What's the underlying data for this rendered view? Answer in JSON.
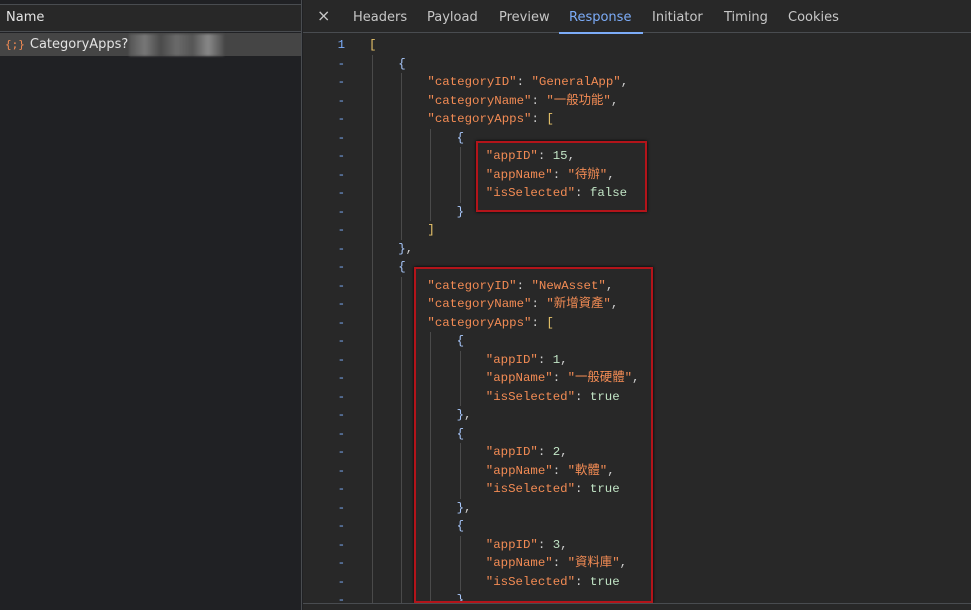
{
  "network": {
    "name_header": "Name",
    "request": {
      "name": "CategoryApps?",
      "icon": "json-braces-icon"
    }
  },
  "tabs": [
    "Headers",
    "Payload",
    "Preview",
    "Response",
    "Initiator",
    "Timing",
    "Cookies"
  ],
  "active_tab": "Response",
  "close_icon": "×",
  "colors": {
    "key": "#f28b54",
    "number": "#c1e4c5",
    "accent": "#7cacf8",
    "highlight_box": "#b3141a"
  },
  "response_lines": [
    {
      "ln": "1",
      "i": 0,
      "t": [
        [
          "br",
          "["
        ]
      ]
    },
    {
      "ln": "-",
      "i": 1,
      "t": [
        [
          "cb",
          "{"
        ]
      ]
    },
    {
      "ln": "-",
      "i": 2,
      "t": [
        [
          "k",
          "\"categoryID\""
        ],
        [
          "p",
          ": "
        ],
        [
          "s",
          "\"GeneralApp\""
        ],
        [
          "p",
          ","
        ]
      ]
    },
    {
      "ln": "-",
      "i": 2,
      "t": [
        [
          "k",
          "\"categoryName\""
        ],
        [
          "p",
          ": "
        ],
        [
          "s",
          "\"一般功能\""
        ],
        [
          "p",
          ","
        ]
      ]
    },
    {
      "ln": "-",
      "i": 2,
      "t": [
        [
          "k",
          "\"categoryApps\""
        ],
        [
          "p",
          ": "
        ],
        [
          "br",
          "["
        ]
      ]
    },
    {
      "ln": "-",
      "i": 3,
      "t": [
        [
          "cb",
          "{"
        ]
      ]
    },
    {
      "ln": "-",
      "i": 4,
      "t": [
        [
          "k",
          "\"appID\""
        ],
        [
          "p",
          ": "
        ],
        [
          "n",
          "15"
        ],
        [
          "p",
          ","
        ]
      ]
    },
    {
      "ln": "-",
      "i": 4,
      "t": [
        [
          "k",
          "\"appName\""
        ],
        [
          "p",
          ": "
        ],
        [
          "s",
          "\"待辦\""
        ],
        [
          "p",
          ","
        ]
      ]
    },
    {
      "ln": "-",
      "i": 4,
      "t": [
        [
          "k",
          "\"isSelected\""
        ],
        [
          "p",
          ": "
        ],
        [
          "n",
          "false"
        ]
      ]
    },
    {
      "ln": "-",
      "i": 3,
      "t": [
        [
          "cb",
          "}"
        ]
      ]
    },
    {
      "ln": "-",
      "i": 2,
      "t": [
        [
          "br",
          "]"
        ]
      ]
    },
    {
      "ln": "-",
      "i": 1,
      "t": [
        [
          "cb",
          "}"
        ],
        [
          "p",
          ","
        ]
      ]
    },
    {
      "ln": "-",
      "i": 1,
      "t": [
        [
          "cb",
          "{"
        ]
      ]
    },
    {
      "ln": "-",
      "i": 2,
      "t": [
        [
          "k",
          "\"categoryID\""
        ],
        [
          "p",
          ": "
        ],
        [
          "s",
          "\"NewAsset\""
        ],
        [
          "p",
          ","
        ]
      ]
    },
    {
      "ln": "-",
      "i": 2,
      "t": [
        [
          "k",
          "\"categoryName\""
        ],
        [
          "p",
          ": "
        ],
        [
          "s",
          "\"新增資產\""
        ],
        [
          "p",
          ","
        ]
      ]
    },
    {
      "ln": "-",
      "i": 2,
      "t": [
        [
          "k",
          "\"categoryApps\""
        ],
        [
          "p",
          ": "
        ],
        [
          "br",
          "["
        ]
      ]
    },
    {
      "ln": "-",
      "i": 3,
      "t": [
        [
          "cb",
          "{"
        ]
      ]
    },
    {
      "ln": "-",
      "i": 4,
      "t": [
        [
          "k",
          "\"appID\""
        ],
        [
          "p",
          ": "
        ],
        [
          "n",
          "1"
        ],
        [
          "p",
          ","
        ]
      ]
    },
    {
      "ln": "-",
      "i": 4,
      "t": [
        [
          "k",
          "\"appName\""
        ],
        [
          "p",
          ": "
        ],
        [
          "s",
          "\"一般硬體\""
        ],
        [
          "p",
          ","
        ]
      ]
    },
    {
      "ln": "-",
      "i": 4,
      "t": [
        [
          "k",
          "\"isSelected\""
        ],
        [
          "p",
          ": "
        ],
        [
          "n",
          "true"
        ]
      ]
    },
    {
      "ln": "-",
      "i": 3,
      "t": [
        [
          "cb",
          "}"
        ],
        [
          "p",
          ","
        ]
      ]
    },
    {
      "ln": "-",
      "i": 3,
      "t": [
        [
          "cb",
          "{"
        ]
      ]
    },
    {
      "ln": "-",
      "i": 4,
      "t": [
        [
          "k",
          "\"appID\""
        ],
        [
          "p",
          ": "
        ],
        [
          "n",
          "2"
        ],
        [
          "p",
          ","
        ]
      ]
    },
    {
      "ln": "-",
      "i": 4,
      "t": [
        [
          "k",
          "\"appName\""
        ],
        [
          "p",
          ": "
        ],
        [
          "s",
          "\"軟體\""
        ],
        [
          "p",
          ","
        ]
      ]
    },
    {
      "ln": "-",
      "i": 4,
      "t": [
        [
          "k",
          "\"isSelected\""
        ],
        [
          "p",
          ": "
        ],
        [
          "n",
          "true"
        ]
      ]
    },
    {
      "ln": "-",
      "i": 3,
      "t": [
        [
          "cb",
          "}"
        ],
        [
          "p",
          ","
        ]
      ]
    },
    {
      "ln": "-",
      "i": 3,
      "t": [
        [
          "cb",
          "{"
        ]
      ]
    },
    {
      "ln": "-",
      "i": 4,
      "t": [
        [
          "k",
          "\"appID\""
        ],
        [
          "p",
          ": "
        ],
        [
          "n",
          "3"
        ],
        [
          "p",
          ","
        ]
      ]
    },
    {
      "ln": "-",
      "i": 4,
      "t": [
        [
          "k",
          "\"appName\""
        ],
        [
          "p",
          ": "
        ],
        [
          "s",
          "\"資料庫\""
        ],
        [
          "p",
          ","
        ]
      ]
    },
    {
      "ln": "-",
      "i": 4,
      "t": [
        [
          "k",
          "\"isSelected\""
        ],
        [
          "p",
          ": "
        ],
        [
          "n",
          "true"
        ]
      ]
    },
    {
      "ln": "-",
      "i": 3,
      "t": [
        [
          "cb",
          "}"
        ],
        [
          "p",
          ","
        ]
      ]
    }
  ]
}
